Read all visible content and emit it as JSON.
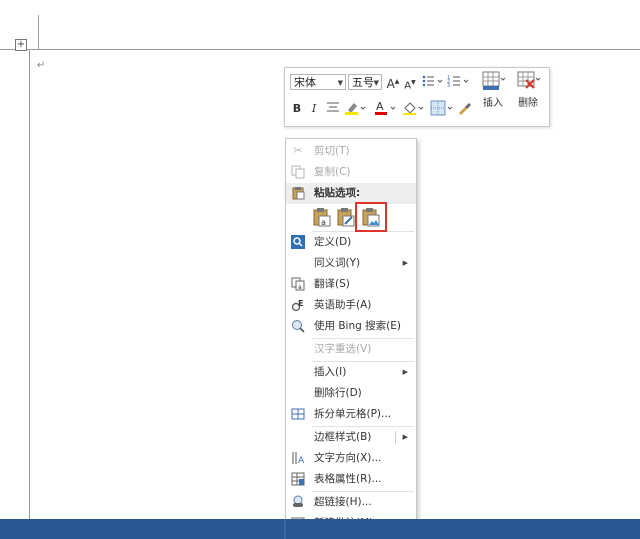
{
  "colors": {
    "accent_blue": "#2b5797",
    "highlight_red": "#e0332b",
    "font_color_red": "#e00000",
    "highlight_yellow": "#f5e600"
  },
  "toolbar": {
    "font_name": "宋体",
    "font_size": "五号",
    "grow_font": "A",
    "shrink_font": "A",
    "bold": "B",
    "italic": "I",
    "font_color_letter": "A",
    "insert_label": "插入",
    "delete_label": "删除"
  },
  "menu": {
    "cut": "剪切(T)",
    "copy": "复制(C)",
    "paste_options": "粘贴选项:",
    "define": "定义(D)",
    "synonyms": "同义词(Y)",
    "translate": "翻译(S)",
    "english_assistant": "英语助手(A)",
    "bing_search": "使用 Bing 搜索(E)",
    "reconvert": "汉字重选(V)",
    "insert": "插入(I)",
    "delete_row": "删除行(D)",
    "split_cells": "拆分单元格(P)...",
    "border_styles": "边框样式(B)",
    "text_direction": "文字方向(X)...",
    "table_properties": "表格属性(R)...",
    "hyperlink": "超链接(H)...",
    "new_comment": "新建批注(M)"
  },
  "icons": {
    "table_move_handle": "move-handle-icon",
    "paragraph_mark": "paragraph-mark-icon"
  }
}
